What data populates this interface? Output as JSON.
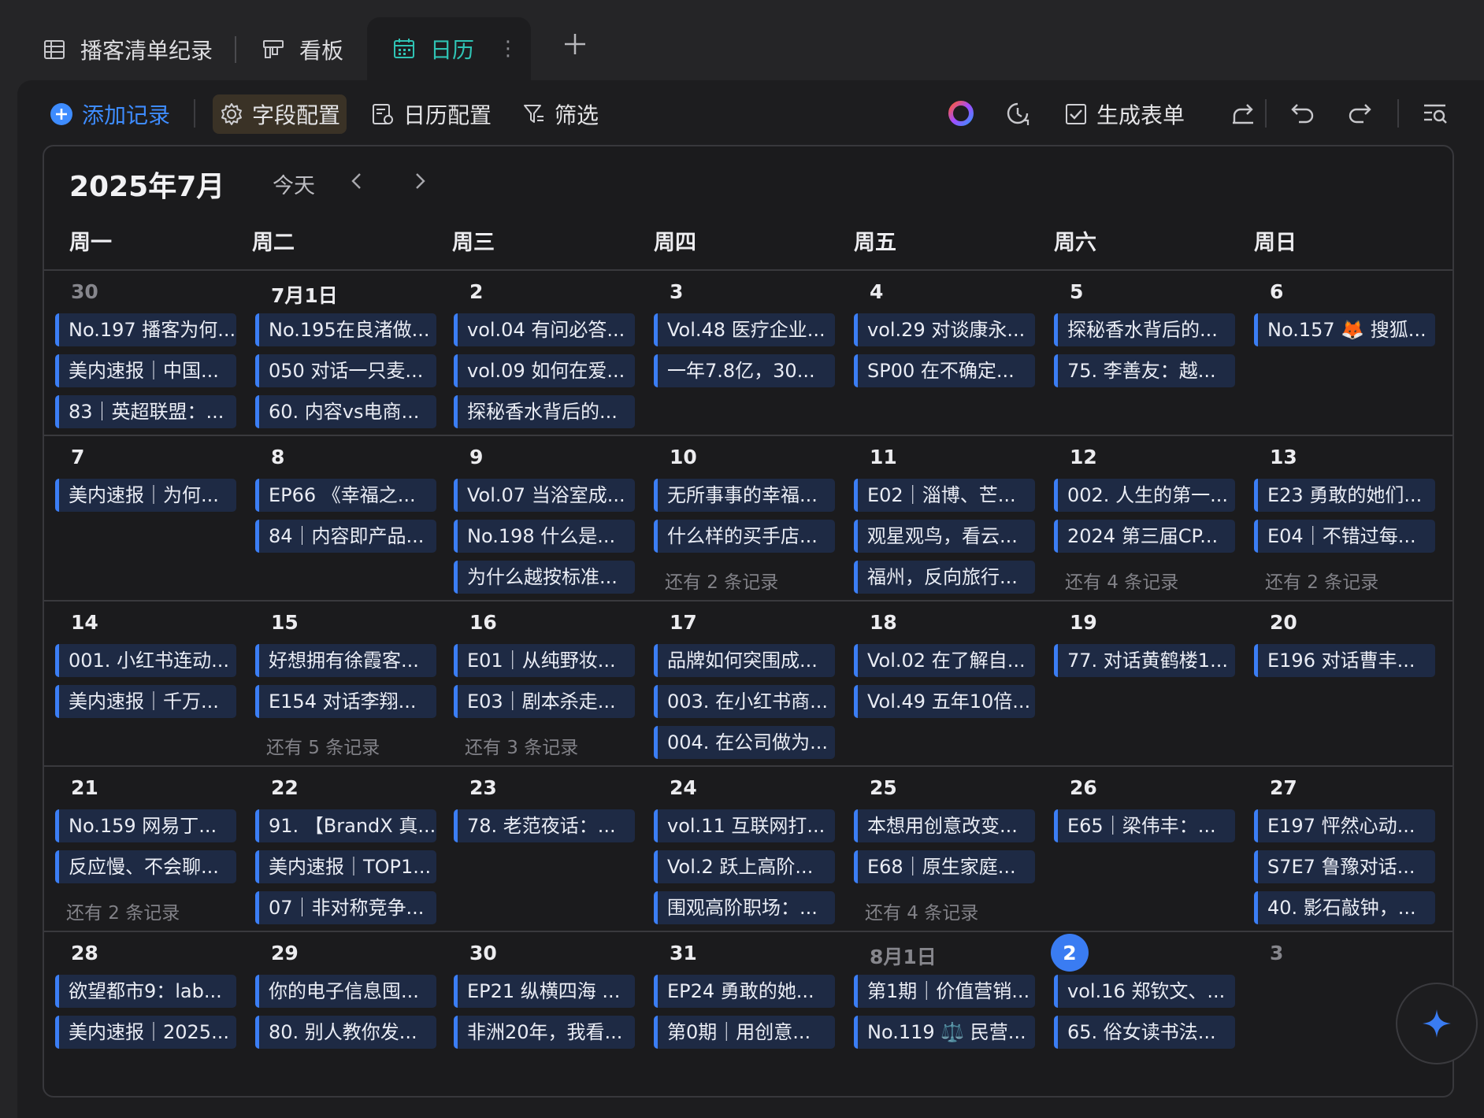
{
  "tabs": [
    {
      "label": "播客清单纪录",
      "icon": "table-icon"
    },
    {
      "label": "看板",
      "icon": "kanban-icon"
    },
    {
      "label": "日历",
      "icon": "calendar-icon",
      "active": true
    }
  ],
  "tab_more": "⋮",
  "toolbar": {
    "add": "添加记录",
    "field_config": "字段配置",
    "calendar_config": "日历配置",
    "filter": "筛选",
    "generate_form": "生成表单"
  },
  "calendar": {
    "month": "2025年7月",
    "today": "今天",
    "weekdays": [
      "周一",
      "周二",
      "周三",
      "周四",
      "周五",
      "周六",
      "周日"
    ],
    "weeks": [
      [
        {
          "day": "30",
          "dim": true,
          "events": [
            "No.197 播客为何...",
            "美内速报｜中国...",
            "83｜英超联盟：..."
          ]
        },
        {
          "day": "7月1日",
          "events": [
            "No.195在良渚做...",
            "050 对话一只麦...",
            "60. 内容vs电商..."
          ]
        },
        {
          "day": "2",
          "events": [
            "vol.04 有问必答...",
            "vol.09 如何在爱...",
            "探秘香水背后的..."
          ]
        },
        {
          "day": "3",
          "events": [
            "Vol.48 医疗企业...",
            "一年7.8亿，30..."
          ]
        },
        {
          "day": "4",
          "events": [
            "vol.29 对谈康永...",
            "SP00 在不确定..."
          ]
        },
        {
          "day": "5",
          "events": [
            "探秘香水背后的...",
            "75. 李善友：越..."
          ]
        },
        {
          "day": "6",
          "events": [
            "No.157 🦊 搜狐..."
          ]
        }
      ],
      [
        {
          "day": "7",
          "events": [
            "美内速报｜为何..."
          ]
        },
        {
          "day": "8",
          "events": [
            "EP66 《幸福之...",
            "84｜内容即产品..."
          ]
        },
        {
          "day": "9",
          "events": [
            "Vol.07 当浴室成...",
            "No.198 什么是...",
            "为什么越按标准..."
          ]
        },
        {
          "day": "10",
          "events": [
            "无所事事的幸福...",
            "什么样的买手店..."
          ],
          "more": "还有 2 条记录"
        },
        {
          "day": "11",
          "events": [
            "E02｜淄博、芒...",
            "观星观鸟，看云...",
            "福州，反向旅行..."
          ]
        },
        {
          "day": "12",
          "events": [
            "002. 人生的第一...",
            "2024 第三届CP..."
          ],
          "more": "还有 4 条记录"
        },
        {
          "day": "13",
          "events": [
            "E23 勇敢的她们...",
            "E04｜不错过每..."
          ],
          "more": "还有 2 条记录"
        }
      ],
      [
        {
          "day": "14",
          "events": [
            "001. 小红书连动...",
            "美内速报｜千万..."
          ]
        },
        {
          "day": "15",
          "events": [
            "好想拥有徐霞客...",
            "E154 对话李翔..."
          ],
          "more": "还有 5 条记录"
        },
        {
          "day": "16",
          "events": [
            "E01｜从纯野妆...",
            "E03｜剧本杀走..."
          ],
          "more": "还有 3 条记录"
        },
        {
          "day": "17",
          "events": [
            "品牌如何突围成...",
            "003. 在小红书商...",
            "004. 在公司做为..."
          ]
        },
        {
          "day": "18",
          "events": [
            "Vol.02 在了解自...",
            "Vol.49 五年10倍..."
          ]
        },
        {
          "day": "19",
          "events": [
            "77. 对话黄鹤楼1..."
          ]
        },
        {
          "day": "20",
          "events": [
            "E196 对话曹丰..."
          ]
        }
      ],
      [
        {
          "day": "21",
          "events": [
            "No.159 网易丁...",
            "反应慢、不会聊..."
          ],
          "more": "还有 2 条记录"
        },
        {
          "day": "22",
          "events": [
            "91. 【BrandX 真...",
            "美内速报｜TOP1...",
            "07｜非对称竞争..."
          ]
        },
        {
          "day": "23",
          "events": [
            "78. 老范夜话：..."
          ]
        },
        {
          "day": "24",
          "events": [
            "vol.11 互联网打...",
            "Vol.2 跃上高阶...",
            "围观高阶职场：..."
          ]
        },
        {
          "day": "25",
          "events": [
            "本想用创意改变...",
            "E68｜原生家庭..."
          ],
          "more": "还有 4 条记录"
        },
        {
          "day": "26",
          "events": [
            "E65｜梁伟丰：..."
          ]
        },
        {
          "day": "27",
          "events": [
            "E197 怦然心动...",
            "S7E7 鲁豫对话...",
            "40. 影石敲钟，..."
          ]
        }
      ],
      [
        {
          "day": "28",
          "events": [
            "欲望都市9：lab...",
            "美内速报｜2025..."
          ]
        },
        {
          "day": "29",
          "events": [
            "你的电子信息囤...",
            "80. 别人教你发..."
          ]
        },
        {
          "day": "30",
          "events": [
            "EP21 纵横四海 ...",
            "非洲20年，我看..."
          ]
        },
        {
          "day": "31",
          "events": [
            "EP24 勇敢的她...",
            "第0期｜用创意..."
          ]
        },
        {
          "day": "8月1日",
          "dim": true,
          "events": [
            "第1期｜价值营销...",
            "No.119 ⚖️ 民营..."
          ]
        },
        {
          "day": "2",
          "current": true,
          "events": [
            "vol.16 郑钦文、...",
            "65. 俗女读书法..."
          ]
        },
        {
          "day": "3",
          "dim": true,
          "events": []
        }
      ]
    ]
  },
  "colors": {
    "accent": "#3e8cff",
    "tab_active": "#2fc3b4",
    "event_bg": "#1e2a44",
    "event_bar": "#3b7ef5"
  }
}
